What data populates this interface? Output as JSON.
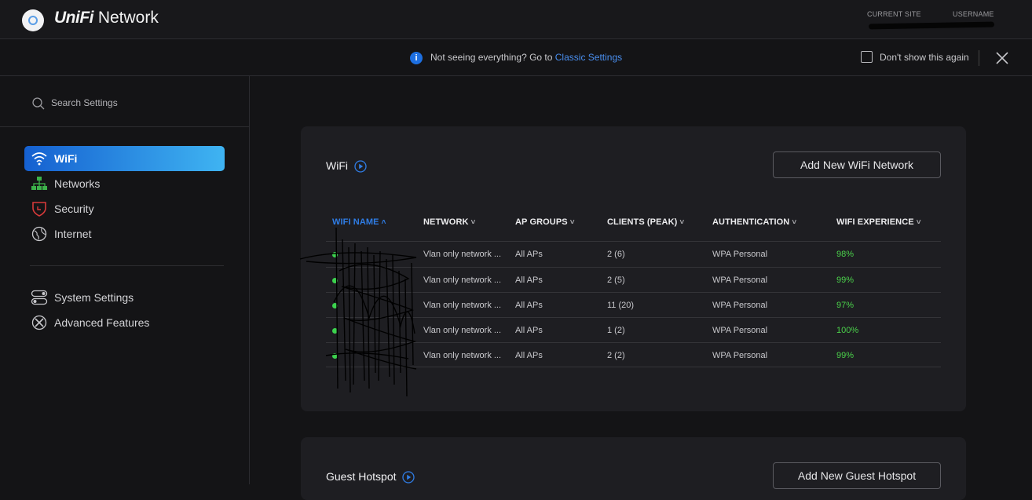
{
  "header": {
    "brand_logo": "UniFi",
    "brand_product": " Network",
    "current_site_label": "CURRENT SITE",
    "username_label": "USERNAME"
  },
  "banner": {
    "text": "Not seeing everything? Go to ",
    "link": "Classic Settings",
    "dont_show": "Don't show this again",
    "info_icon": "i"
  },
  "sidebar": {
    "search_placeholder": "Search Settings",
    "items": [
      {
        "label": "WiFi",
        "icon": "wifi-icon",
        "active": true
      },
      {
        "label": "Networks",
        "icon": "networks-icon",
        "active": false
      },
      {
        "label": "Security",
        "icon": "shield-icon",
        "active": false
      },
      {
        "label": "Internet",
        "icon": "globe-icon",
        "active": false
      }
    ],
    "secondary_items": [
      {
        "label": "System Settings",
        "icon": "toggles-icon"
      },
      {
        "label": "Advanced Features",
        "icon": "tools-icon"
      }
    ]
  },
  "wifi_card": {
    "title": "WiFi",
    "add_button": "Add New WiFi Network",
    "columns": [
      {
        "label": "WIFI NAME",
        "caret": "^",
        "sorted": true
      },
      {
        "label": "NETWORK",
        "caret": "v"
      },
      {
        "label": "AP GROUPS",
        "caret": "v"
      },
      {
        "label": "CLIENTS (PEAK)",
        "caret": "v"
      },
      {
        "label": "AUTHENTICATION",
        "caret": "v"
      },
      {
        "label": "WIFI EXPERIENCE",
        "caret": "v"
      }
    ],
    "rows": [
      {
        "network": "Vlan only network ...",
        "ap_groups": "All APs",
        "clients": "2 (6)",
        "auth": "WPA Personal",
        "experience": "98%"
      },
      {
        "network": "Vlan only network ...",
        "ap_groups": "All APs",
        "clients": "2 (5)",
        "auth": "WPA Personal",
        "experience": "99%"
      },
      {
        "network": "Vlan only network ...",
        "ap_groups": "All APs",
        "clients": "11 (20)",
        "auth": "WPA Personal",
        "experience": "97%"
      },
      {
        "network": "Vlan only network ...",
        "ap_groups": "All APs",
        "clients": "1 (2)",
        "auth": "WPA Personal",
        "experience": "100%"
      },
      {
        "network": "Vlan only network ...",
        "ap_groups": "All APs",
        "clients": "2 (2)",
        "auth": "WPA Personal",
        "experience": "99%"
      }
    ]
  },
  "guest_card": {
    "title": "Guest Hotspot",
    "add_button": "Add New Guest Hotspot"
  },
  "colors": {
    "accent": "#2f7de6",
    "active_gradient_start": "#1560d0",
    "active_gradient_end": "#3fb4f2",
    "status_green": "#4bd24b"
  }
}
